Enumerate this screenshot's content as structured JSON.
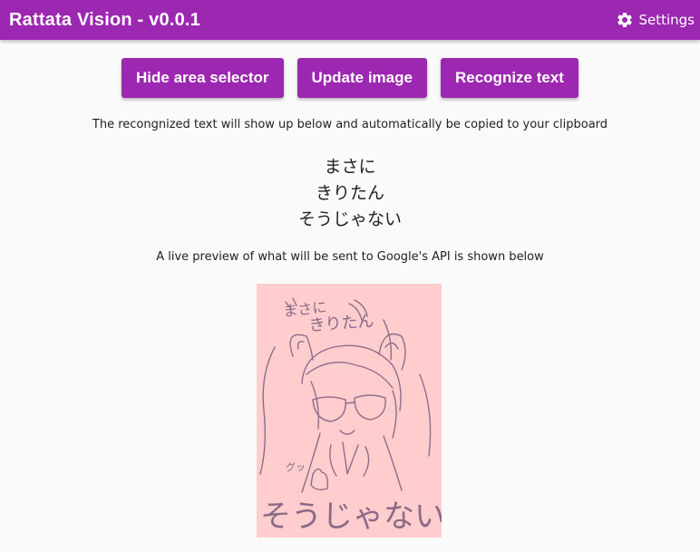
{
  "header": {
    "title": "Rattata Vision - v0.0.1",
    "settings_label": "Settings",
    "settings_icon": "gear-icon",
    "accent_color": "#9c27b0"
  },
  "toolbar": {
    "hide_selector_label": "Hide area selector",
    "update_image_label": "Update image",
    "recognize_text_label": "Recognize text"
  },
  "main": {
    "recognized_note": "The recongnized text will show up below and automatically be copied to your clipboard",
    "recognized_lines": [
      "まさに",
      "きりたん",
      "そうじゃない"
    ],
    "preview_note": "A live preview of what will be sent to Google's API is shown below",
    "preview": {
      "bubble_text_1": "まさに",
      "bubble_text_2": "きりたん",
      "side_text": "グッ",
      "bottom_text": "そうじゃない",
      "background_color": "#ffcdcd"
    }
  }
}
